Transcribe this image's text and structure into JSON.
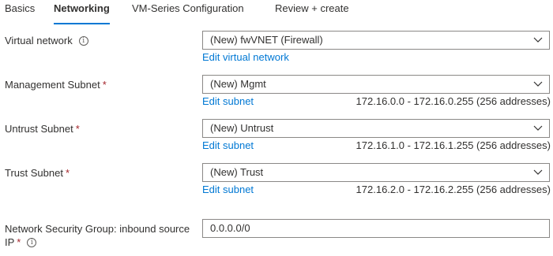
{
  "tabs": [
    {
      "label": "Basics"
    },
    {
      "label": "Networking"
    },
    {
      "label": "VM-Series Configuration"
    },
    {
      "label": "Review + create"
    }
  ],
  "active_tab": "Networking",
  "virtual_network": {
    "label": "Virtual network",
    "value": "(New) fwVNET (Firewall)",
    "link": "Edit virtual network"
  },
  "management_subnet": {
    "label": "Management Subnet",
    "required": "*",
    "value": "(New) Mgmt",
    "link": "Edit subnet",
    "address": "172.16.0.0 - 172.16.0.255 (256 addresses)"
  },
  "untrust_subnet": {
    "label": "Untrust Subnet",
    "required": "*",
    "value": "(New) Untrust",
    "link": "Edit subnet",
    "address": "172.16.1.0 - 172.16.1.255 (256 addresses)"
  },
  "trust_subnet": {
    "label": "Trust Subnet",
    "required": "*",
    "value": "(New) Trust",
    "link": "Edit subnet",
    "address": "172.16.2.0 - 172.16.2.255 (256 addresses)"
  },
  "nsg": {
    "label_line1": "Network Security Group: inbound source",
    "label_line2": "IP",
    "required": "*",
    "value": "0.0.0.0/0"
  },
  "colors": {
    "accent": "#0078d4",
    "required": "#a4262c",
    "border": "#8a8886"
  },
  "icons": {
    "info": "info-icon",
    "dropdown": "chevron-down-icon"
  }
}
